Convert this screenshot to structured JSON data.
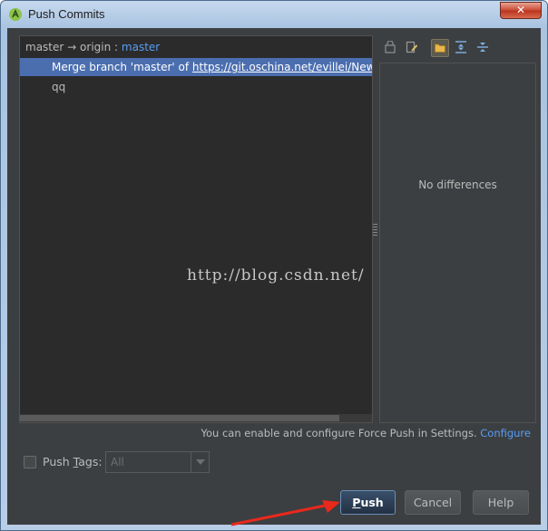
{
  "window": {
    "title": "Push Commits",
    "close_glyph": "✕"
  },
  "commit_tree": {
    "root_local_branch": "master",
    "root_arrow": "→",
    "root_remote": "origin :",
    "root_remote_branch": "master",
    "commits": [
      {
        "prefix": "Merge branch 'master' of ",
        "url": "https://git.oschina.net/evillei/NewP",
        "selected": true
      },
      {
        "prefix": "qq",
        "url": "",
        "selected": false
      }
    ]
  },
  "diff_panel": {
    "empty_text": "No differences"
  },
  "toolbar": {
    "icons": [
      "edit-source-icon",
      "edit-commit-icon",
      "group-by-directory-icon",
      "expand-all-icon",
      "collapse-all-icon"
    ],
    "active_index": 2
  },
  "watermark": "http://blog.csdn.net/",
  "force_push": {
    "text": "You can enable and configure Force Push in Settings.",
    "link": "Configure"
  },
  "push_tags": {
    "label_before": "Push ",
    "label_mnemonic": "T",
    "label_after": "ags:",
    "checked": false,
    "value": "All"
  },
  "buttons": {
    "push_mnemonic": "P",
    "push_rest": "ush",
    "cancel": "Cancel",
    "help": "Help"
  },
  "colors": {
    "background": "#3c3f41",
    "selection": "#4b6eaf",
    "link": "#589df6",
    "annotation_arrow": "#e8291c"
  }
}
